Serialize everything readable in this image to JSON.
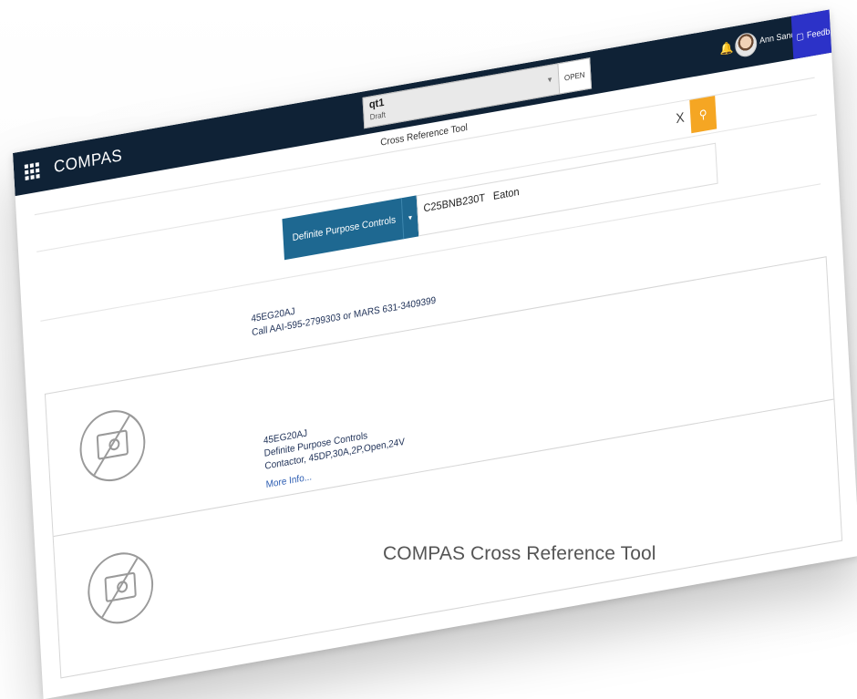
{
  "app": {
    "title": "COMPAS",
    "project": {
      "name": "qt1",
      "status": "Draft"
    },
    "open_label": "OPEN",
    "user_name": "Ann Sandy",
    "feedback_label": "Feedback"
  },
  "page": {
    "subtitle": "Cross Reference Tool"
  },
  "search": {
    "value": "",
    "clear_label": "X"
  },
  "filter": {
    "category": "Definite Purpose Controls",
    "query_parts": [
      "C25BNB230T",
      "Eaton"
    ]
  },
  "result_top": {
    "part": "45EG20AJ",
    "note": "Call AAI-595-2799303 or MARS 631-3409399"
  },
  "results": [
    {
      "image_alt": "No image available"
    },
    {
      "image_alt": "No image available",
      "part": "45EG20AJ",
      "category": "Definite Purpose Controls",
      "description": "Contactor, 45DP,30A,2P,Open,24V",
      "more_label": "More Info..."
    }
  ],
  "caption": "COMPAS Cross Reference Tool"
}
